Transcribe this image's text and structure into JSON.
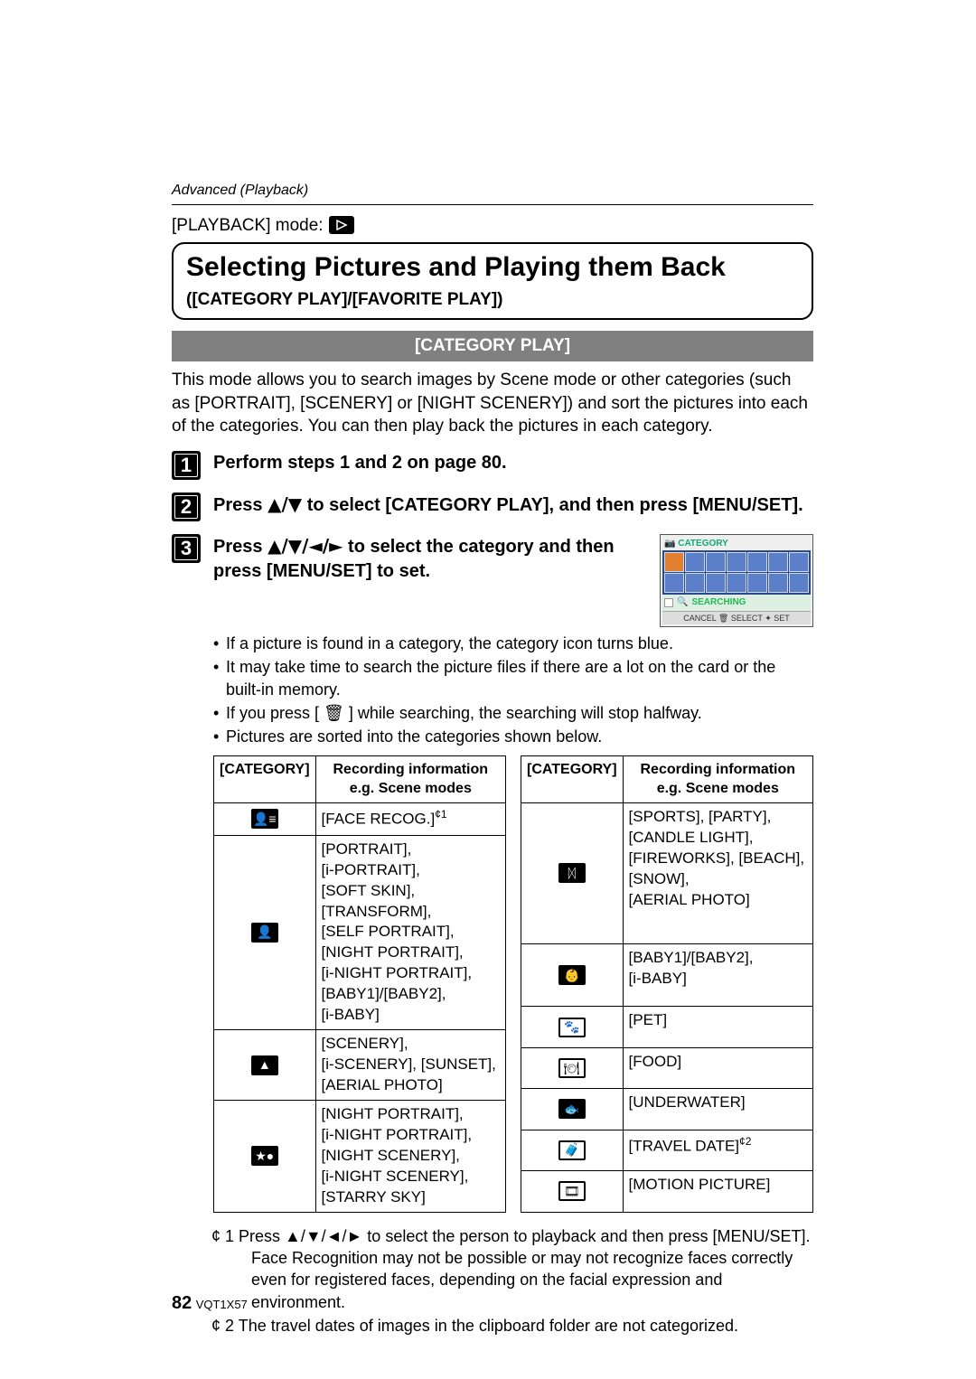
{
  "header": {
    "section_label": "Advanced (Playback)",
    "mode_label": "[PLAYBACK] mode:"
  },
  "title": {
    "main": "Selecting Pictures and Playing them Back",
    "sub": "([CATEGORY PLAY]/[FAVORITE PLAY])"
  },
  "section_heading": "[CATEGORY PLAY]",
  "intro": "This mode allows you to search images by Scene mode or other categories (such as [PORTRAIT], [SCENERY] or [NIGHT SCENERY]) and sort the pictures into each of the categories. You can then play back the pictures in each category.",
  "steps": {
    "s1": "Perform steps 1 and 2 on page 80.",
    "s2_pre": "Press ",
    "s2_arrows": "▲/▼",
    "s2_post": " to select [CATEGORY PLAY], and then press [MENU/SET].",
    "s3_pre": "Press ",
    "s3_arrows": "▲/▼/◄/►",
    "s3_post": " to select the category and then press [MENU/SET] to set.",
    "s3_bullets": [
      "If a picture is found in a category, the category icon turns blue.",
      "It may take time to search the picture files if there are a lot on the card or the built-in memory.",
      "If you press [ 🗑 ] while searching, the searching will stop halfway.",
      "Pictures are sorted into the categories shown below."
    ]
  },
  "screenshot": {
    "category": "CATEGORY",
    "searching": "SEARCHING",
    "bottom": "CANCEL 🗑 SELECT ✦ SET"
  },
  "table_headers": {
    "col1": "[CATEGORY]",
    "col2a": "Recording information",
    "col2b": "e.g. Scene modes"
  },
  "table_left": [
    {
      "icon": "face-recog-icon",
      "text": "[FACE RECOG.]¢1"
    },
    {
      "icon": "portrait-icon",
      "text": "[PORTRAIT],\n[i-PORTRAIT],\n[SOFT SKIN],\n[TRANSFORM],\n[SELF PORTRAIT],\n[NIGHT PORTRAIT],\n[i-NIGHT PORTRAIT],\n[BABY1]/[BABY2],\n[i-BABY]"
    },
    {
      "icon": "scenery-icon",
      "text": "[SCENERY],\n[i-SCENERY], [SUNSET],\n[AERIAL PHOTO]"
    },
    {
      "icon": "night-scenery-icon",
      "text": "[NIGHT PORTRAIT],\n[i-NIGHT PORTRAIT],\n[NIGHT SCENERY],\n[i-NIGHT SCENERY],\n[STARRY SKY]"
    }
  ],
  "table_right": [
    {
      "icon": "sports-icon",
      "text": "[SPORTS], [PARTY],\n[CANDLE LIGHT],\n[FIREWORKS], [BEACH],\n[SNOW],\n[AERIAL PHOTO]"
    },
    {
      "icon": "baby-icon",
      "text": "[BABY1]/[BABY2],\n[i-BABY]"
    },
    {
      "icon": "pet-icon",
      "text": "[PET]"
    },
    {
      "icon": "food-icon",
      "text": "[FOOD]"
    },
    {
      "icon": "underwater-icon",
      "text": "[UNDERWATER]"
    },
    {
      "icon": "travel-icon",
      "text": "[TRAVEL DATE]¢2"
    },
    {
      "icon": "motion-icon",
      "text": "[MOTION PICTURE]"
    }
  ],
  "footnotes": {
    "f1": "¢ 1 Press ▲/▼/◄/► to select the person to playback and then press [MENU/SET]. Face Recognition may not be possible or may not recognize faces correctly even for registered faces, depending on the facial expression and environment.",
    "f2": "¢ 2 The travel dates of images in the clipboard folder are not categorized."
  },
  "footer": {
    "page_number": "82",
    "doc_code": "VQT1X57"
  },
  "icon_glyphs": {
    "face-recog-icon": "👤≡",
    "portrait-icon": "👤",
    "scenery-icon": "▲",
    "night-scenery-icon": "★●",
    "sports-icon": "ᛞ",
    "baby-icon": "👶",
    "pet-icon": "🐾",
    "food-icon": "🍽",
    "underwater-icon": "🐟",
    "travel-icon": "🧳",
    "motion-icon": "🎞"
  }
}
